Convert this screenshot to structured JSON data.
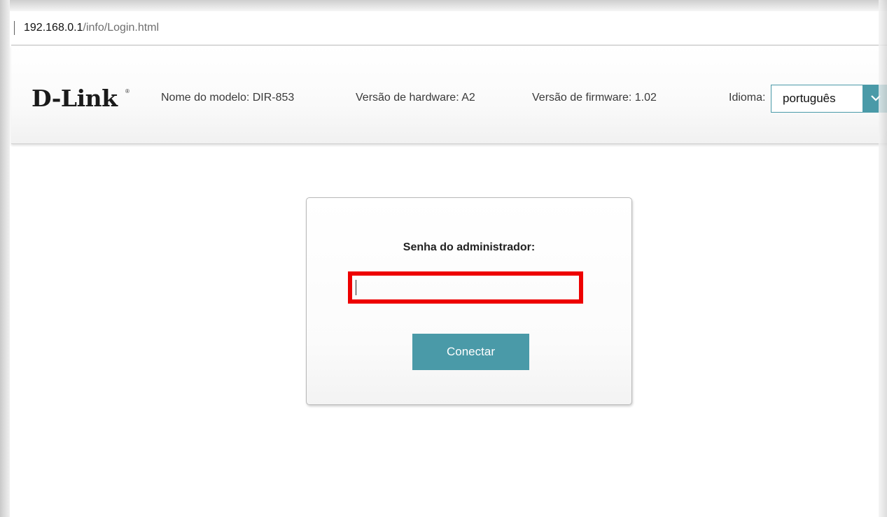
{
  "browser": {
    "url_host": "192.168.0.1",
    "url_path": "/info/Login.html"
  },
  "header": {
    "logo_text": "D-Link",
    "logo_registered": "®",
    "model_label": "Nome do modelo: DIR-853",
    "hardware_label": "Versão de hardware: A2",
    "firmware_label": "Versão de firmware: 1.02",
    "language_label": "Idioma:",
    "language_value": "português",
    "language_arrow_icon": "chevron-down-icon"
  },
  "login": {
    "title": "Senha do administrador:",
    "password_value": "",
    "connect_label": "Conectar"
  },
  "colors": {
    "accent": "#4a9aa8",
    "highlight": "#ee0000"
  }
}
